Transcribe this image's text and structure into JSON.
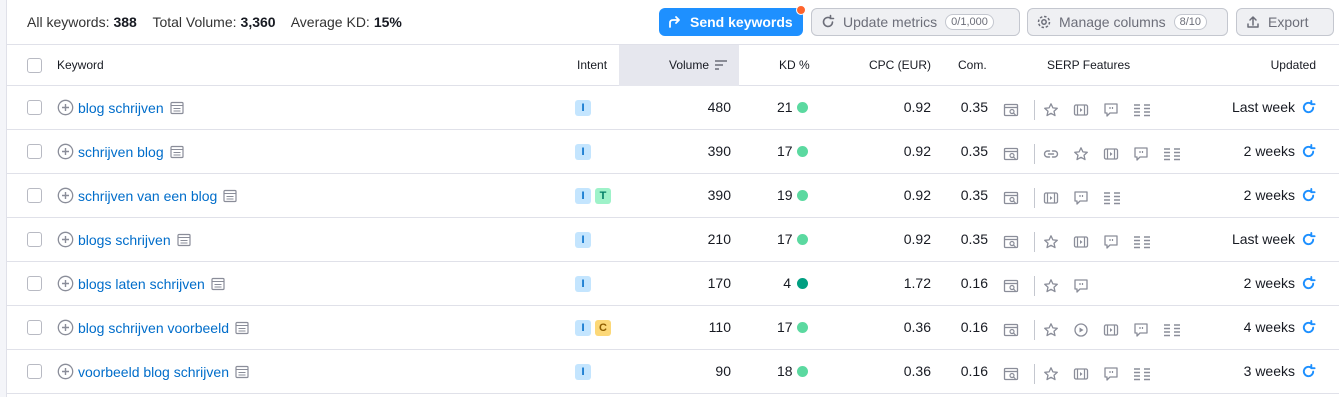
{
  "summary": {
    "all_keywords_label": "All keywords:",
    "all_keywords_value": "388",
    "total_volume_label": "Total Volume:",
    "total_volume_value": "3,360",
    "avg_kd_label": "Average KD:",
    "avg_kd_value": "15%"
  },
  "toolbar": {
    "send_label": "Send keywords",
    "update_label": "Update metrics",
    "update_count": "0/1,000",
    "manage_label": "Manage columns",
    "manage_count": "8/10",
    "export_label": "Export"
  },
  "columns": {
    "keyword": "Keyword",
    "intent": "Intent",
    "volume": "Volume",
    "kd": "KD %",
    "cpc": "CPC (EUR)",
    "com": "Com.",
    "serp": "SERP Features",
    "updated": "Updated"
  },
  "colors": {
    "link": "#006dca",
    "primary": "#1e90ff",
    "kd_light": "#5bd9a0",
    "kd_dark": "#009f81",
    "intent_i_bg": "#c4e5fe",
    "intent_i_fg": "#006dca",
    "intent_t_bg": "#9ef2c9",
    "intent_t_fg": "#007c65",
    "intent_c_bg": "#fcd878",
    "intent_c_fg": "#8f5e00"
  },
  "rows": [
    {
      "keyword": "blog schrijven",
      "intents": [
        "I"
      ],
      "volume": "480",
      "kd": "21",
      "kd_level": "light",
      "cpc": "0.92",
      "com": "0.35",
      "features": [
        "star-icon",
        "video-icon",
        "quote-icon",
        "list-icon"
      ],
      "updated": "Last week"
    },
    {
      "keyword": "schrijven blog",
      "intents": [
        "I"
      ],
      "volume": "390",
      "kd": "17",
      "kd_level": "light",
      "cpc": "0.92",
      "com": "0.35",
      "features": [
        "link-icon",
        "star-icon",
        "video-icon",
        "quote-icon",
        "list-icon"
      ],
      "updated": "2 weeks"
    },
    {
      "keyword": "schrijven van een blog",
      "intents": [
        "I",
        "T"
      ],
      "volume": "390",
      "kd": "19",
      "kd_level": "light",
      "cpc": "0.92",
      "com": "0.35",
      "features": [
        "video-icon",
        "quote-icon",
        "list-icon"
      ],
      "updated": "2 weeks"
    },
    {
      "keyword": "blogs schrijven",
      "intents": [
        "I"
      ],
      "volume": "210",
      "kd": "17",
      "kd_level": "light",
      "cpc": "0.92",
      "com": "0.35",
      "features": [
        "star-icon",
        "video-icon",
        "quote-icon",
        "list-icon"
      ],
      "updated": "Last week"
    },
    {
      "keyword": "blogs laten schrijven",
      "intents": [
        "I"
      ],
      "volume": "170",
      "kd": "4",
      "kd_level": "dark",
      "cpc": "1.72",
      "com": "0.16",
      "features": [
        "star-icon",
        "quote-icon"
      ],
      "updated": "2 weeks"
    },
    {
      "keyword": "blog schrijven voorbeeld",
      "intents": [
        "I",
        "C"
      ],
      "volume": "110",
      "kd": "17",
      "kd_level": "light",
      "cpc": "0.36",
      "com": "0.16",
      "features": [
        "star-icon",
        "play-icon",
        "video-icon",
        "quote-icon",
        "list-icon"
      ],
      "updated": "4 weeks"
    },
    {
      "keyword": "voorbeeld blog schrijven",
      "intents": [
        "I"
      ],
      "volume": "90",
      "kd": "18",
      "kd_level": "light",
      "cpc": "0.36",
      "com": "0.16",
      "features": [
        "star-icon",
        "video-icon",
        "quote-icon",
        "list-icon"
      ],
      "updated": "3 weeks"
    }
  ]
}
